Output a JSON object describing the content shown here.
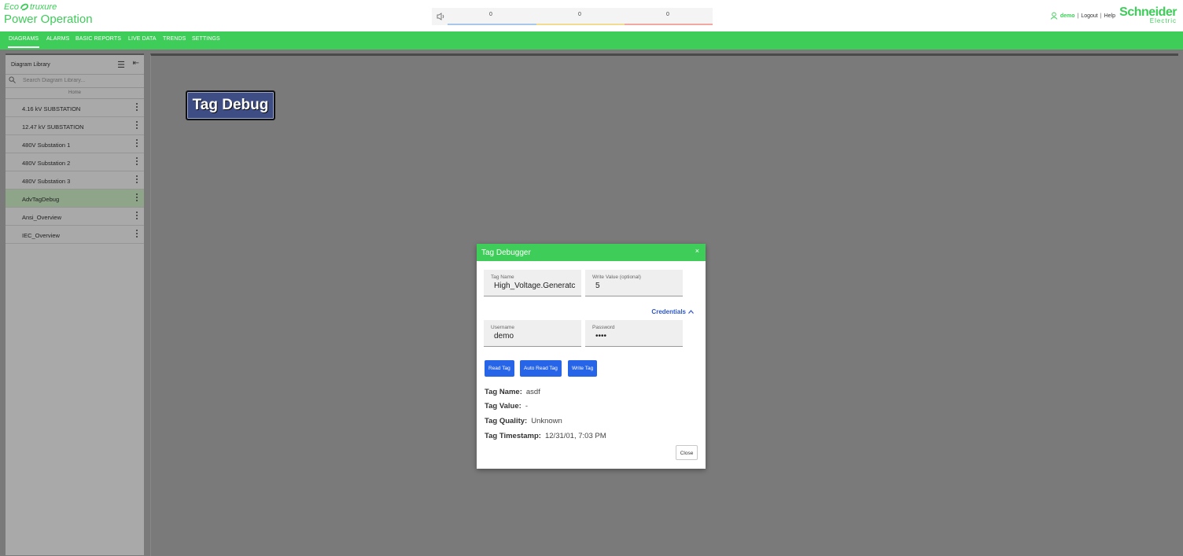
{
  "brand": {
    "eco_a": "Eco",
    "eco_b": "truxure",
    "product": "Power Operation",
    "color": "#3dcd58"
  },
  "alarm_bar": {
    "counts": [
      "0",
      "0",
      "0"
    ],
    "colors": [
      "#a8c8ea",
      "#f2dc8f",
      "#f0a8a0"
    ]
  },
  "user": {
    "name": "demo",
    "logout": "Logout",
    "help": "Help",
    "sep": "|"
  },
  "logo": {
    "line1": "Schneider",
    "line2": "Electric"
  },
  "nav": {
    "items": [
      "DIAGRAMS",
      "ALARMS",
      "BASIC REPORTS",
      "LIVE DATA",
      "TRENDS",
      "SETTINGS"
    ]
  },
  "sidebar": {
    "title": "Diagram Library",
    "search_placeholder": "Search Diagram Library...",
    "home": "Home",
    "items": [
      "4.16 kV SUBSTATION",
      "12.47 kV SUBSTATION",
      "480V Substation 1",
      "480V Substation 2",
      "480V Substation 3",
      "AdvTagDebug",
      "Ansi_Overview",
      "IEC_Overview"
    ],
    "selected": "AdvTagDebug"
  },
  "canvas": {
    "tag_debug_button": "Tag Debug"
  },
  "dialog": {
    "title": "Tag Debugger",
    "close_x": "×",
    "tag_name_label": "Tag Name",
    "tag_name_value": "High_Voltage.Generatc",
    "write_value_label": "Write Value (optional)",
    "write_value": "5",
    "credentials_label": "Credentials",
    "username_label": "Username",
    "username_value": "demo",
    "password_label": "Password",
    "password_value": "demo",
    "read_tag": "Read Tag",
    "auto_read_tag": "Auto Read Tag",
    "write_tag": "Write Tag",
    "result": {
      "name_label": "Tag Name:",
      "name_value": "asdf",
      "value_label": "Tag Value:",
      "value_value": "-",
      "quality_label": "Tag Quality:",
      "quality_value": "Unknown",
      "timestamp_label": "Tag Timestamp:",
      "timestamp_value": "12/31/01, 7:03 PM"
    },
    "close_button": "Close"
  }
}
